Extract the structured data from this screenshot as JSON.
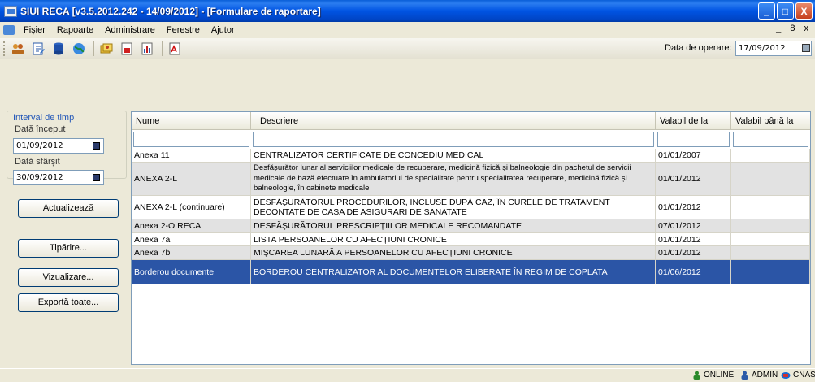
{
  "window": {
    "title": "SIUI RECA [v3.5.2012.242 - 14/09/2012] - [Formulare de raportare]",
    "btn_minimize": "_",
    "btn_maximize": "□",
    "btn_close": "X"
  },
  "menu": {
    "items": [
      "Fișier",
      "Rapoarte",
      "Administrare",
      "Ferestre",
      "Ajutor"
    ],
    "mdi_controls": "_ 8 x"
  },
  "toolbar": {
    "icons": [
      "users-icon",
      "edit-document-icon",
      "database-icon",
      "globe-icon",
      "cards-icon",
      "form-icon",
      "chart-icon",
      "pdf-icon"
    ],
    "operation_date_label": "Data de operare:",
    "operation_date_value": "17/09/2012"
  },
  "left_panel": {
    "interval_label": "Interval de timp",
    "start_label": "Dată început",
    "start_value": "01/09/2012",
    "end_label": "Dată sfârșit",
    "end_value": "30/09/2012",
    "buttons": {
      "refresh": "Actualizează",
      "print": "Tipărire...",
      "view": "Vizualizare...",
      "export_all": "Exportă toate..."
    }
  },
  "grid": {
    "columns": [
      "Nume",
      "Descriere",
      "Valabil de la",
      "Valabil până la"
    ],
    "rows": [
      {
        "name": "Anexa 11",
        "desc": "CENTRALIZATOR CERTIFICATE DE CONCEDIU MEDICAL",
        "from": "01/01/2007",
        "to": ""
      },
      {
        "name": "ANEXA 2-L",
        "desc": "Desfășurător lunar al serviciilor medicale de recuperare, medicină fizică și balneologie din pachetul de servicii medicale de bază efectuate în ambulatoriul de specialitate pentru specialitatea recuperare, medicină fizică și balneologie, în cabinete medicale",
        "from": "01/01/2012",
        "to": ""
      },
      {
        "name": "ANEXA 2-L (continuare)",
        "desc": "DESFĂȘURĂTORUL PROCEDURILOR, INCLUSE DUPĂ CAZ, ÎN CURELE DE TRATAMENT DECONTATE DE CASA DE ASIGURARI DE SANATATE",
        "from": "01/01/2012",
        "to": ""
      },
      {
        "name": "Anexa 2-O RECA",
        "desc": "DESFĂȘURĂTORUL PRESCRIPȚIILOR MEDICALE RECOMANDATE",
        "from": "07/01/2012",
        "to": ""
      },
      {
        "name": "Anexa 7a",
        "desc": "LISTA PERSOANELOR CU AFECȚIUNI CRONICE",
        "from": "01/01/2012",
        "to": ""
      },
      {
        "name": "Anexa 7b",
        "desc": "MIȘCAREA LUNARĂ A PERSOANELOR CU AFECȚIUNI CRONICE",
        "from": "01/01/2012",
        "to": ""
      },
      {
        "name": "Borderou documente",
        "desc": "BORDEROU CENTRALIZATOR AL DOCUMENTELOR ELIBERATE ÎN REGIM DE COPLATA",
        "from": "01/06/2012",
        "to": ""
      }
    ],
    "selected_row": 6
  },
  "status": {
    "online": "ONLINE",
    "user": "ADMIN",
    "house": "CNAS"
  }
}
